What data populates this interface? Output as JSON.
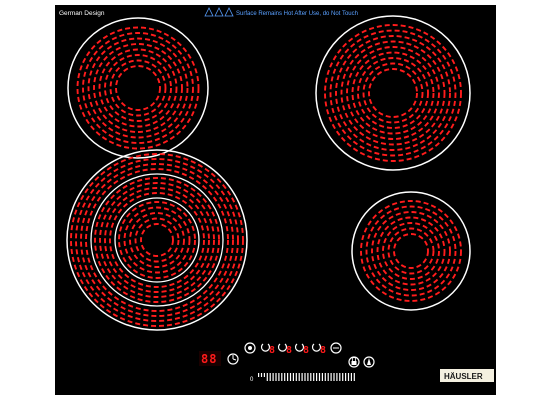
{
  "panel": {
    "origin_label": "German Design",
    "warning_text": "Surface Remains Hot After Use, do Not Touch",
    "brand": "HÄUSLER"
  },
  "zones": [
    {
      "name": "rear-left",
      "type": "single"
    },
    {
      "name": "rear-right",
      "type": "single"
    },
    {
      "name": "front-left",
      "type": "triple"
    },
    {
      "name": "front-right",
      "type": "single"
    }
  ],
  "controls": {
    "timer_display": "88",
    "zone_displays": [
      "8",
      "8",
      "8",
      "8"
    ],
    "slider_min_label": "0",
    "icons": [
      "timer-icon",
      "power-icon",
      "zone-select-icon",
      "lock-icon",
      "boost-icon",
      "keep-warm-icon"
    ]
  },
  "colors": {
    "glass": "#000000",
    "ring": "#ffffff",
    "heating_element": "#ff1c1c",
    "warning": "#5aa0ff"
  }
}
